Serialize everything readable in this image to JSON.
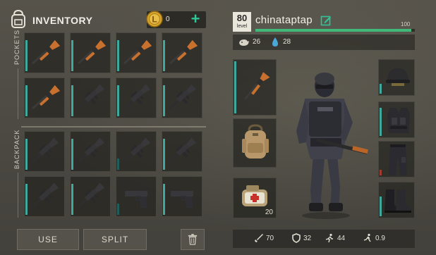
{
  "header": {
    "title": "INVENTORY",
    "coins": "0",
    "add_label": "+"
  },
  "sections": {
    "pockets": "POCKETS",
    "backpack": "BACKPACK"
  },
  "pockets": [
    {
      "item": "shotgun",
      "durability": 0.85
    },
    {
      "item": "shotgun",
      "durability": 0.85
    },
    {
      "item": "shotgun",
      "durability": 0.85
    },
    {
      "item": "shotgun",
      "durability": 0.85
    },
    {
      "item": "shotgun",
      "durability": 0.85
    },
    {
      "item": "assault-rifle",
      "durability": 0.85
    },
    {
      "item": "assault-rifle",
      "durability": 0.85
    },
    {
      "item": "assault-rifle",
      "durability": 0.85
    }
  ],
  "backpack": [
    {
      "item": "assault-rifle",
      "durability": 0.85
    },
    {
      "item": "assault-rifle",
      "durability": 0.85
    },
    {
      "item": "assault-rifle",
      "durability": 0.3
    },
    {
      "item": "assault-rifle",
      "durability": 0.85
    },
    {
      "item": "assault-rifle",
      "durability": 0.85
    },
    {
      "item": "assault-rifle",
      "durability": 0.85
    },
    {
      "item": "pistol",
      "durability": 0.3
    },
    {
      "item": "pistol",
      "durability": 0.85
    }
  ],
  "actions": {
    "use": "USE",
    "split": "SPLIT"
  },
  "player": {
    "level": "80",
    "level_label": "level",
    "name": "chinataptap",
    "xp_value": "100",
    "xp_fraction": 0.98,
    "food": "26",
    "water": "28"
  },
  "equipment": {
    "weapon": "shotgun",
    "backpack": "backpack",
    "medkit": "medkit",
    "medkit_count": "20",
    "helmet": "helmet",
    "vest": "tactical-vest",
    "pants": "pants",
    "boots": "boots"
  },
  "stats": {
    "attack": "70",
    "defense": "32",
    "speed": "44",
    "stealth": "0.9"
  },
  "colors": {
    "accent": "#2fc596",
    "xp": "#3fb87a",
    "durability": "#3fa99e",
    "damaged": "#a33a32"
  }
}
